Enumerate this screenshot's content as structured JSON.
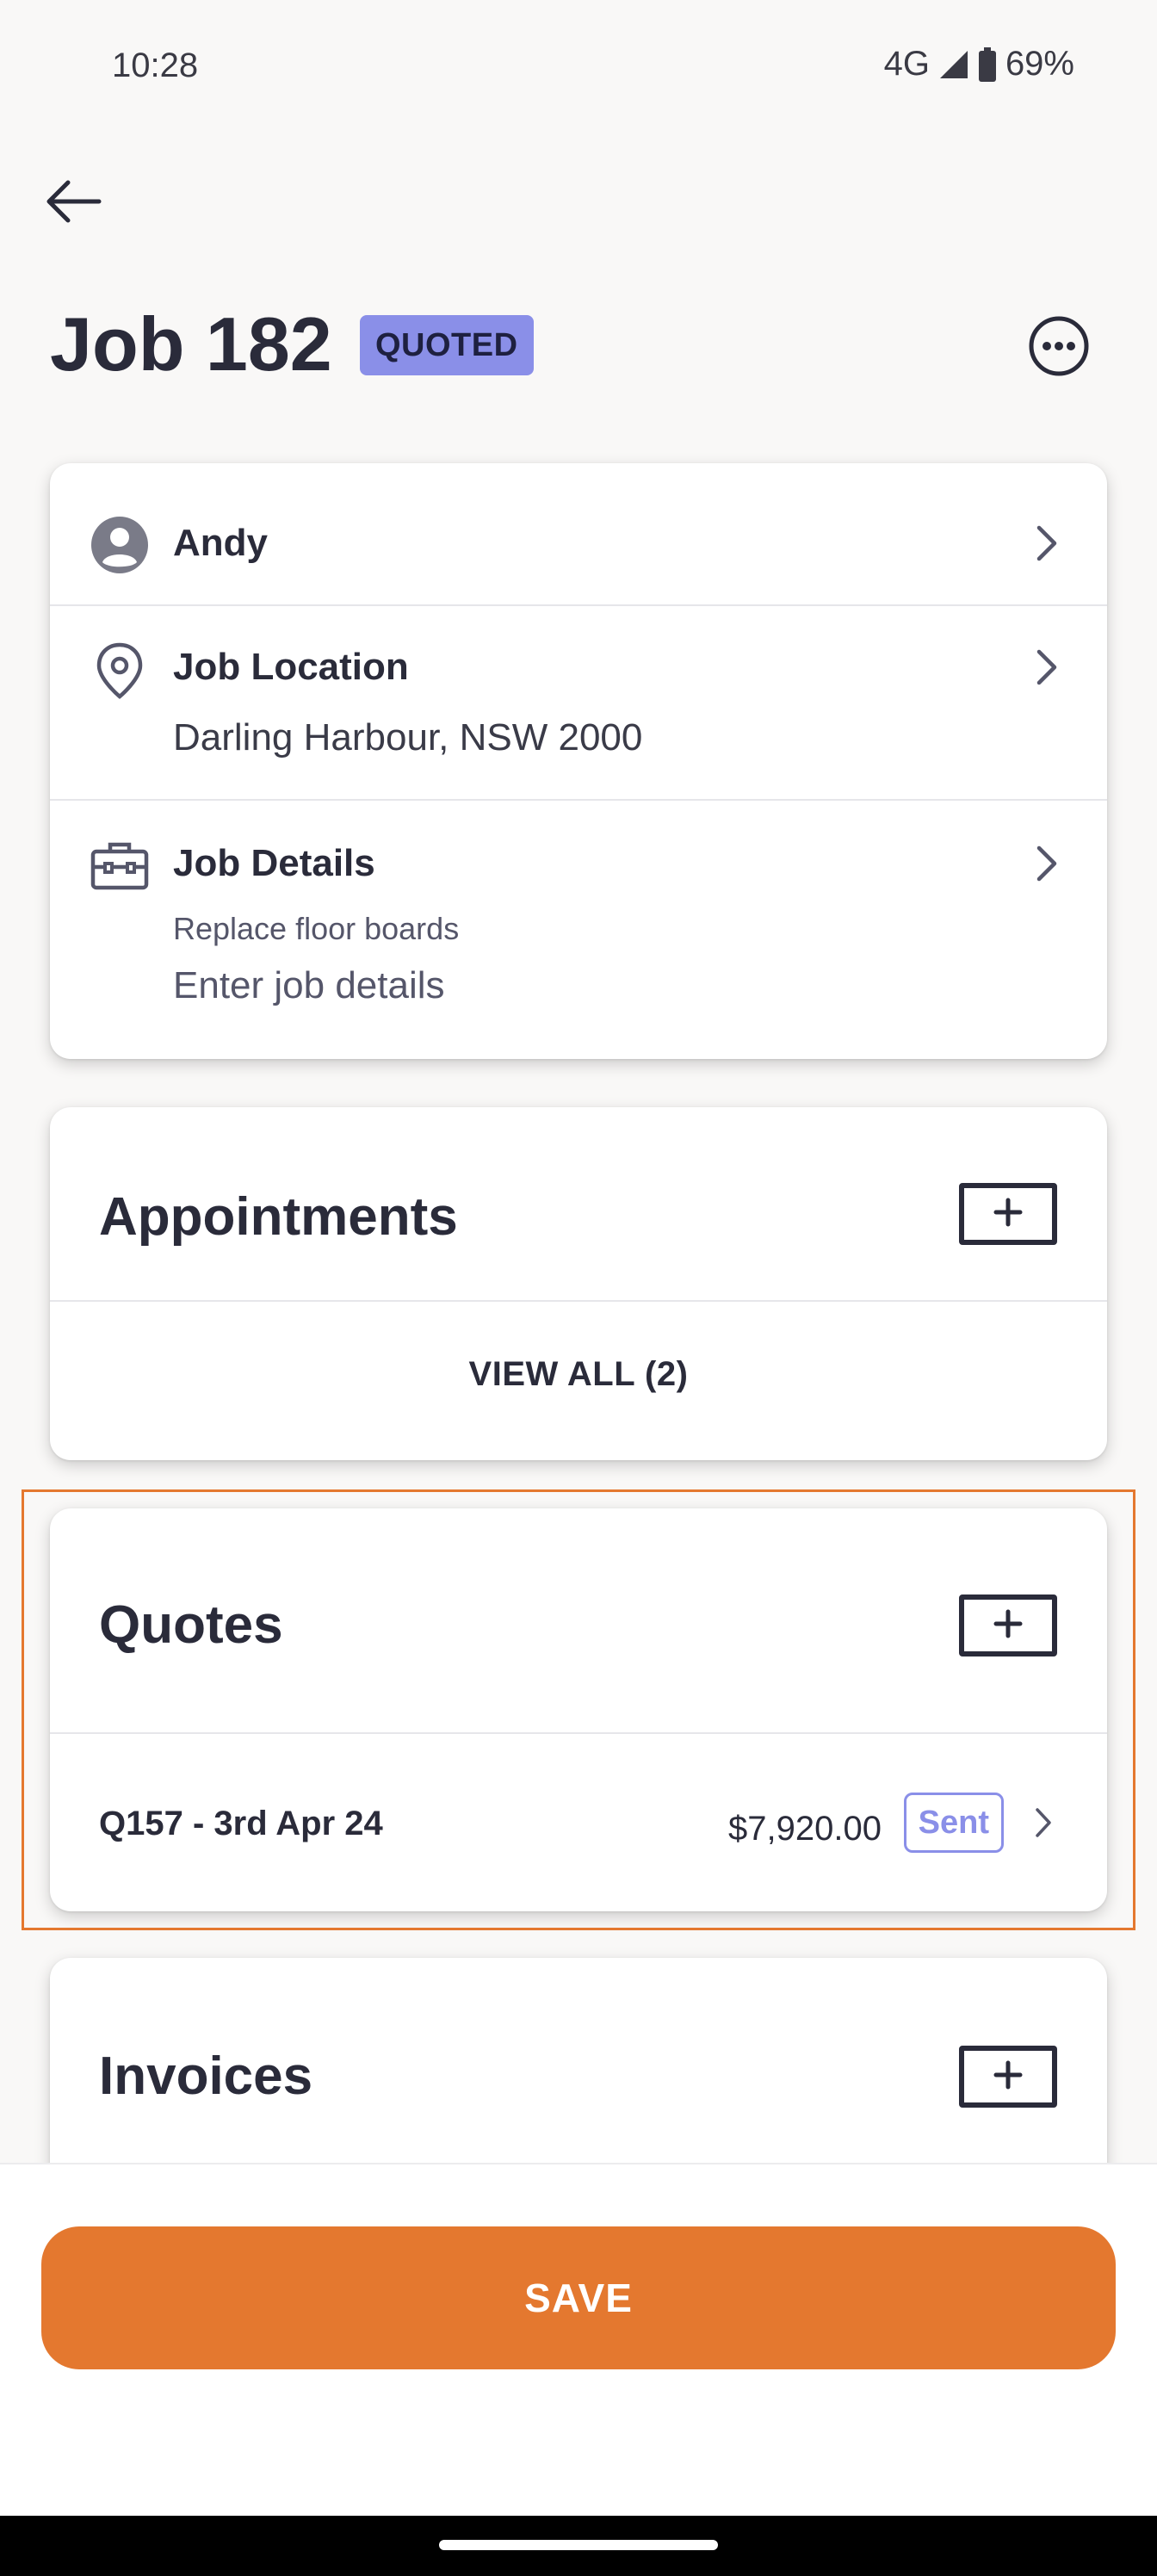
{
  "status_bar": {
    "time": "10:28",
    "network": "4G",
    "battery": "69%",
    "icons": [
      "signal-icon",
      "battery-icon"
    ]
  },
  "header": {
    "title": "Job 182",
    "status": "QUOTED",
    "icons": [
      "back-arrow-icon",
      "more-options-icon"
    ]
  },
  "details_card": {
    "customer": {
      "name": "Andy",
      "icon": "person-icon"
    },
    "location": {
      "title": "Job Location",
      "value": "Darling Harbour, NSW 2000",
      "icon": "location-pin-icon"
    },
    "job_details": {
      "title": "Job Details",
      "subtitle": "Replace floor boards",
      "placeholder": "Enter job details",
      "icon": "toolbox-icon"
    }
  },
  "appointments": {
    "title": "Appointments",
    "view_all": "VIEW ALL (2)"
  },
  "quotes": {
    "title": "Quotes",
    "items": [
      {
        "label": "Q157 - 3rd Apr 24",
        "amount": "$7,920.00",
        "status": "Sent"
      }
    ]
  },
  "invoices": {
    "title": "Invoices"
  },
  "footer": {
    "save_label": "SAVE"
  },
  "colors": {
    "accent": "#e4782f",
    "badge": "#8a8fe8",
    "text": "#2a2b3a"
  }
}
